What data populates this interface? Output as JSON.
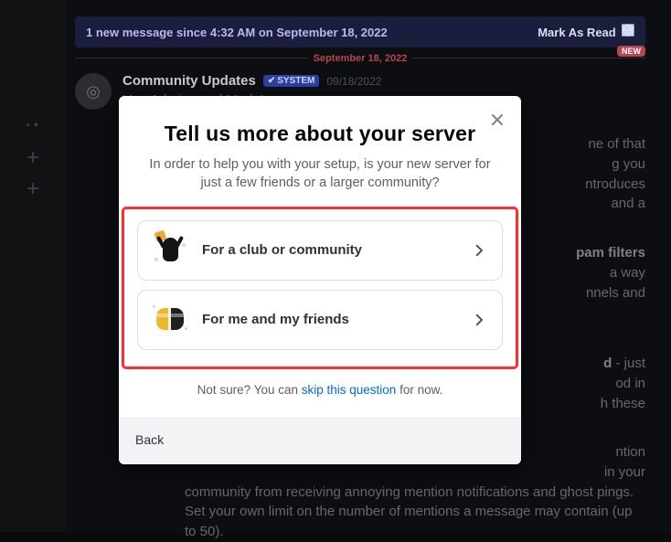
{
  "banner": {
    "newMessage": "1 new message since 4:32 AM on September 18, 2022",
    "markRead": "Mark As Read"
  },
  "divider": {
    "date": "September 18, 2022",
    "badge": "NEW"
  },
  "message": {
    "user": "Community Updates",
    "system": "SYSTEM",
    "date": "09/18/2022",
    "greeting": "Hey Admins and Mods!"
  },
  "back": {
    "p1_a": "ne of that",
    "p1_b": "g you",
    "p1_c": "ntroduces",
    "p1_d": "and a",
    "p2_head": "pam filters",
    "p2_a": "a way",
    "p2_b": "nnels and",
    "p3_head": "d",
    "p3_a": " - just",
    "p3_b": "od in",
    "p3_c": "h these",
    "p4_a": "ntion",
    "p4_b": "in your",
    "p4_c": "community from receiving annoying mention notifications and ghost pings. Set your own limit on the number of mentions a message may contain (up to 50)."
  },
  "modal": {
    "title": "Tell us more about your server",
    "subtitle": "In order to help you with your setup, is your new server for just a few friends or a larger community?",
    "opt_club": "For a club or community",
    "opt_friends": "For me and my friends",
    "skip_pre": "Not sure? You can ",
    "skip_link": "skip this question",
    "skip_post": " for now.",
    "back": "Back"
  }
}
